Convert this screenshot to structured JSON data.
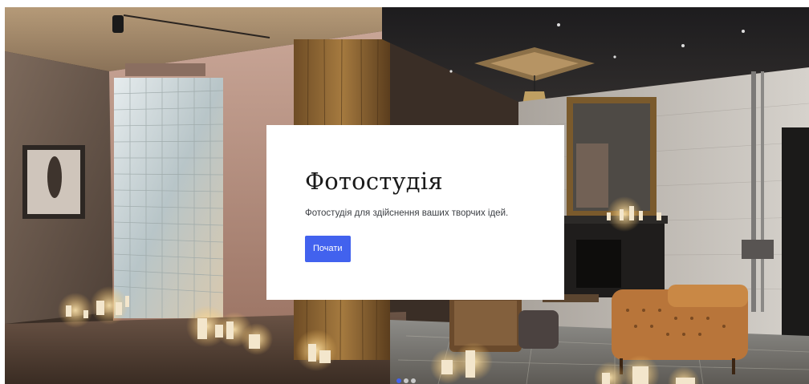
{
  "hero": {
    "image_label": "photo-studio-interior",
    "title": "Фотостудія",
    "description": "Фотостудія для здійснення ваших творчих ідей.",
    "cta_label": "Почати"
  },
  "carousel": {
    "slide_count": 3,
    "active_index": 0
  },
  "colors": {
    "accent": "#4262ee",
    "card_bg": "#ffffff"
  }
}
